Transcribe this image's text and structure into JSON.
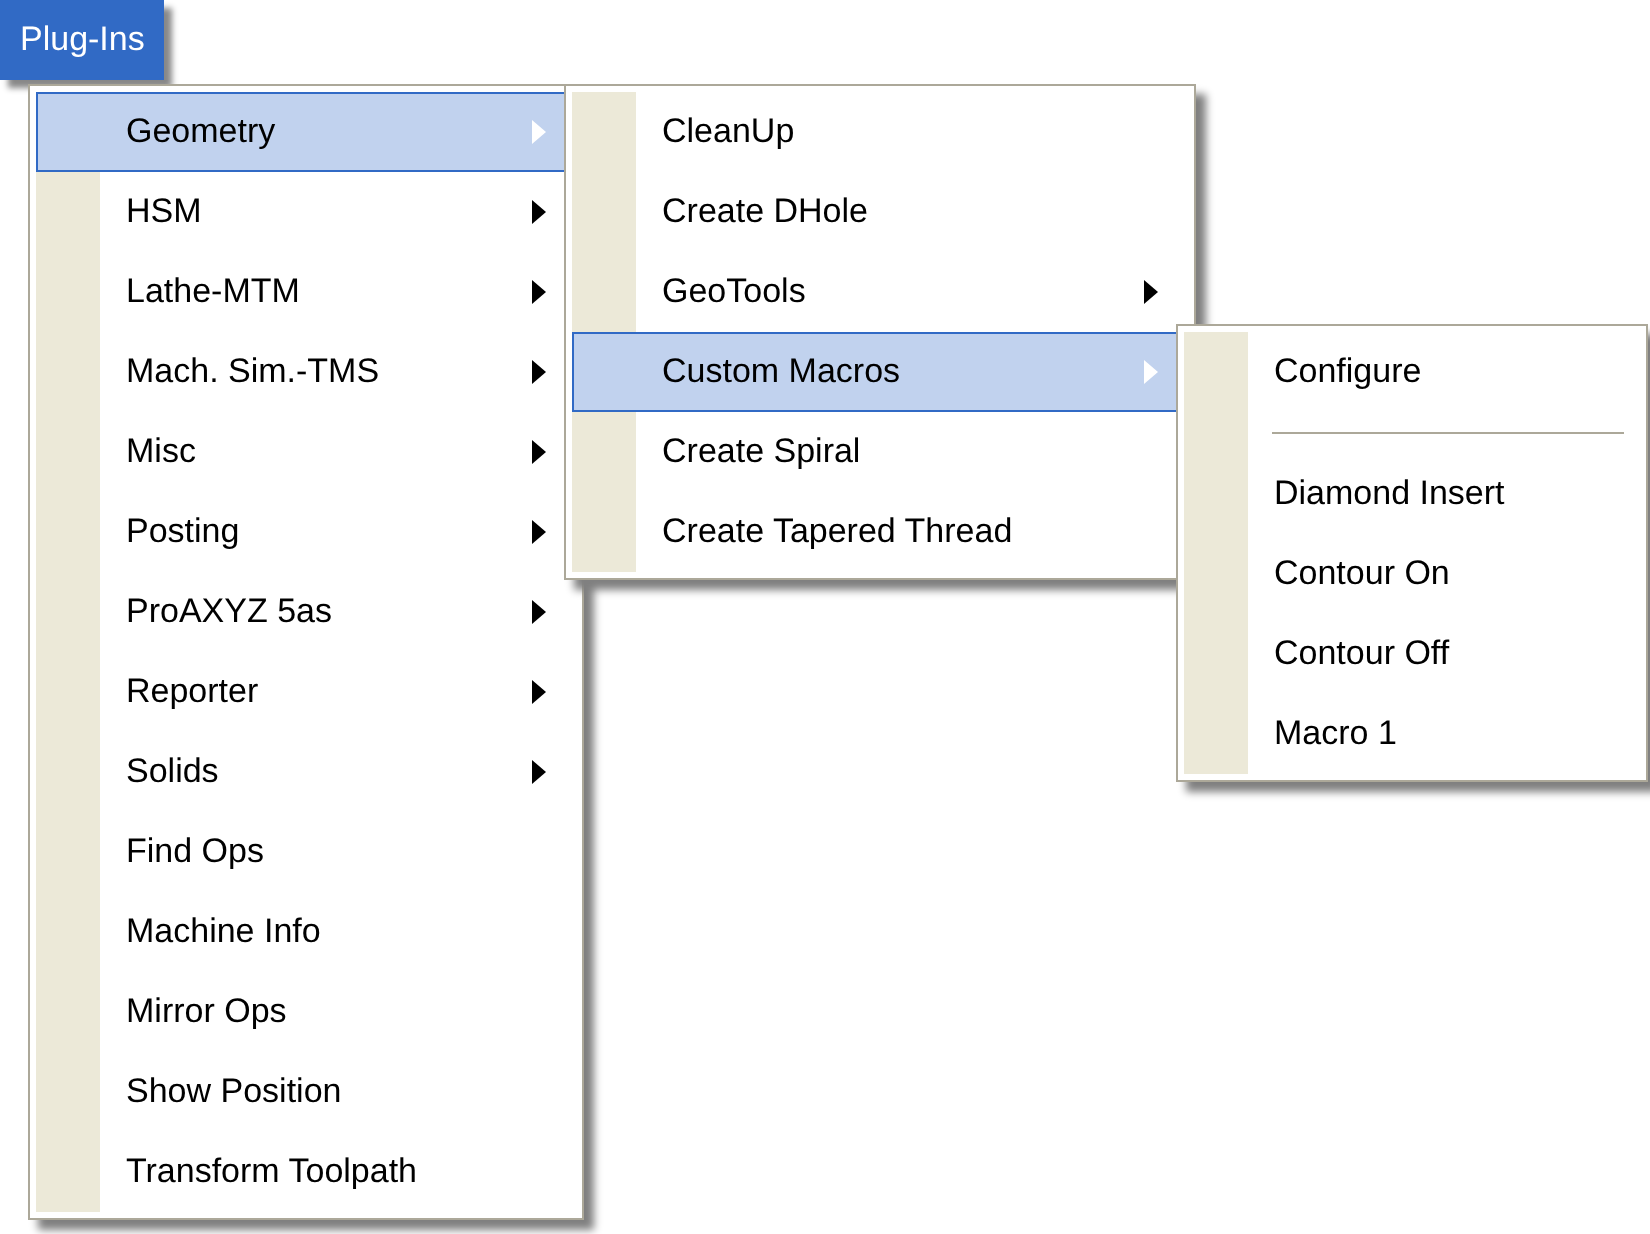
{
  "menu_bar": {
    "title": "Plug-Ins",
    "selected": true
  },
  "menus": [
    {
      "items": [
        {
          "kind": "item",
          "label": "Geometry",
          "has_submenu": true,
          "selected": true
        },
        {
          "kind": "item",
          "label": "HSM",
          "has_submenu": true,
          "selected": false
        },
        {
          "kind": "item",
          "label": "Lathe-MTM",
          "has_submenu": true,
          "selected": false
        },
        {
          "kind": "item",
          "label": "Mach. Sim.-TMS",
          "has_submenu": true,
          "selected": false
        },
        {
          "kind": "item",
          "label": "Misc",
          "has_submenu": true,
          "selected": false
        },
        {
          "kind": "item",
          "label": "Posting",
          "has_submenu": true,
          "selected": false
        },
        {
          "kind": "item",
          "label": "ProAXYZ 5as",
          "has_submenu": true,
          "selected": false
        },
        {
          "kind": "item",
          "label": "Reporter",
          "has_submenu": true,
          "selected": false
        },
        {
          "kind": "item",
          "label": "Solids",
          "has_submenu": true,
          "selected": false
        },
        {
          "kind": "item",
          "label": "Find Ops",
          "has_submenu": false,
          "selected": false
        },
        {
          "kind": "item",
          "label": "Machine Info",
          "has_submenu": false,
          "selected": false
        },
        {
          "kind": "item",
          "label": "Mirror Ops",
          "has_submenu": false,
          "selected": false
        },
        {
          "kind": "item",
          "label": "Show Position",
          "has_submenu": false,
          "selected": false
        },
        {
          "kind": "item",
          "label": "Transform Toolpath",
          "has_submenu": false,
          "selected": false
        }
      ]
    },
    {
      "items": [
        {
          "kind": "item",
          "label": "CleanUp",
          "has_submenu": false,
          "selected": false
        },
        {
          "kind": "item",
          "label": "Create DHole",
          "has_submenu": false,
          "selected": false
        },
        {
          "kind": "item",
          "label": "GeoTools",
          "has_submenu": true,
          "selected": false
        },
        {
          "kind": "item",
          "label": "Custom Macros",
          "has_submenu": true,
          "selected": true
        },
        {
          "kind": "item",
          "label": "Create Spiral",
          "has_submenu": false,
          "selected": false
        },
        {
          "kind": "item",
          "label": "Create Tapered Thread",
          "has_submenu": false,
          "selected": false
        }
      ]
    },
    {
      "items": [
        {
          "kind": "item",
          "label": "Configure",
          "has_submenu": false,
          "selected": false
        },
        {
          "kind": "separator"
        },
        {
          "kind": "item",
          "label": "Diamond Insert",
          "has_submenu": false,
          "selected": false
        },
        {
          "kind": "item",
          "label": "Contour On",
          "has_submenu": false,
          "selected": false
        },
        {
          "kind": "item",
          "label": "Contour Off",
          "has_submenu": false,
          "selected": false
        },
        {
          "kind": "item",
          "label": "Macro 1",
          "has_submenu": false,
          "selected": false
        }
      ]
    }
  ]
}
